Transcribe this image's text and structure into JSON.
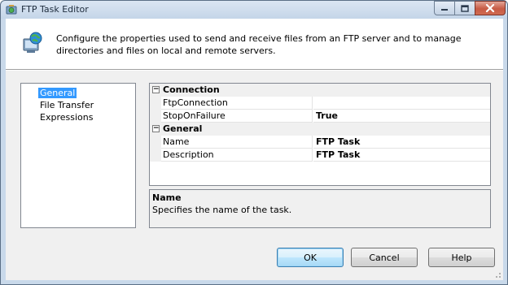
{
  "window": {
    "title": "FTP Task Editor"
  },
  "header": {
    "description": "Configure the properties used to send and receive files from an FTP server and to manage directories and files on local and remote servers."
  },
  "nav": {
    "items": [
      {
        "label": "General",
        "selected": true
      },
      {
        "label": "File Transfer",
        "selected": false
      },
      {
        "label": "Expressions",
        "selected": false
      }
    ]
  },
  "properties": {
    "categories": [
      {
        "label": "Connection",
        "toggle": "⊟",
        "rows": [
          {
            "name": "FtpConnection",
            "value": ""
          },
          {
            "name": "StopOnFailure",
            "value": "True"
          }
        ]
      },
      {
        "label": "General",
        "toggle": "⊟",
        "rows": [
          {
            "name": "Name",
            "value": "FTP Task"
          },
          {
            "name": "Description",
            "value": "FTP Task"
          }
        ]
      }
    ]
  },
  "description_pane": {
    "title": "Name",
    "text": "Specifies the name of the task."
  },
  "buttons": {
    "ok": "OK",
    "cancel": "Cancel",
    "help": "Help"
  },
  "icons": {
    "app": "ftp-task-icon",
    "header": "globe-computer-icon",
    "minimize": "minimize-icon",
    "maximize": "maximize-icon",
    "close": "close-icon"
  },
  "colors": {
    "selection": "#3399ff",
    "close_button": "#c75b45",
    "default_button_border": "#3c7fb1"
  }
}
